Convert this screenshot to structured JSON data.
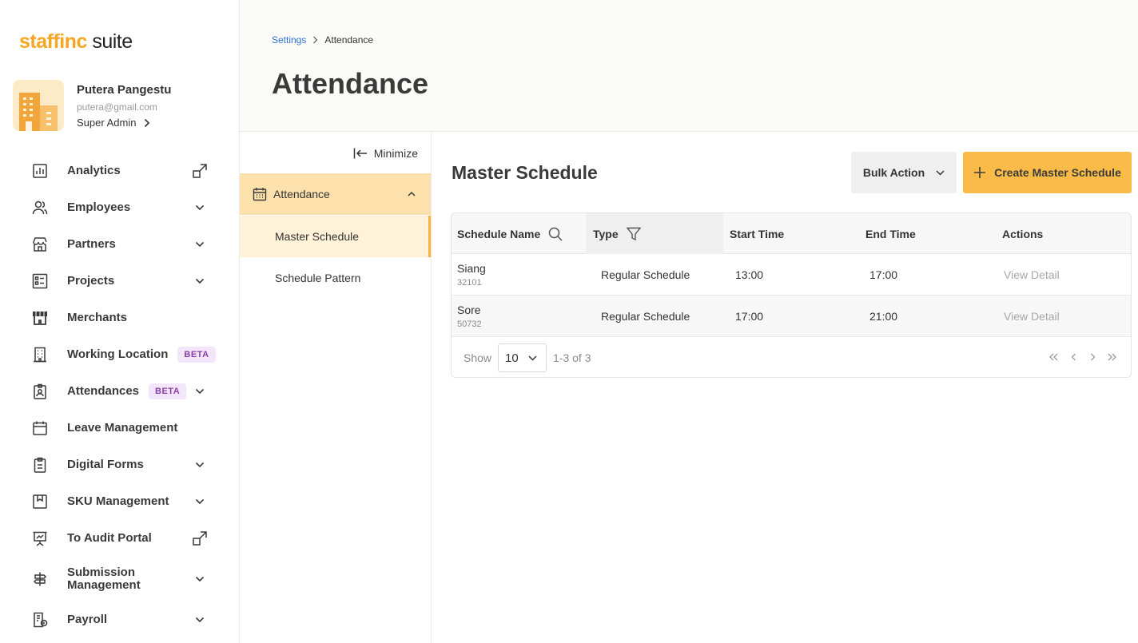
{
  "app": {
    "logo_brand": "staffinc",
    "logo_suffix": " suite",
    "accent_color": "#fbbb48"
  },
  "user": {
    "name": "Putera Pangestu",
    "email": "putera@gmail.com",
    "role": "Super Admin"
  },
  "sidebar": {
    "items": [
      {
        "label": "Analytics",
        "icon": "chart-icon",
        "right": "external-link"
      },
      {
        "label": "Employees",
        "icon": "users-icon",
        "right": "chevron-down"
      },
      {
        "label": "Partners",
        "icon": "store-icon",
        "right": "chevron-down"
      },
      {
        "label": "Projects",
        "icon": "list-icon",
        "right": "chevron-down"
      },
      {
        "label": "Merchants",
        "icon": "shop-icon",
        "right": ""
      },
      {
        "label": "Working Location",
        "icon": "building-icon",
        "badge": "BETA",
        "right": ""
      },
      {
        "label": "Attendances",
        "icon": "badge-icon",
        "badge": "BETA",
        "right": "chevron-down"
      },
      {
        "label": "Leave Management",
        "icon": "calendar-icon",
        "right": ""
      },
      {
        "label": "Digital Forms",
        "icon": "clipboard-icon",
        "right": "chevron-down"
      },
      {
        "label": "SKU Management",
        "icon": "bookmark-icon",
        "right": "chevron-down"
      },
      {
        "label": "To Audit Portal",
        "icon": "presentation-icon",
        "right": "external-link"
      },
      {
        "label": "Submission Management",
        "icon": "signpost-icon",
        "right": "chevron-down"
      },
      {
        "label": "Payroll",
        "icon": "payroll-icon",
        "right": "chevron-down"
      }
    ]
  },
  "header": {
    "breadcrumb_parent": "Settings",
    "breadcrumb_current": "Attendance",
    "title": "Attendance"
  },
  "subnav": {
    "minimize_label": "Minimize",
    "group_label": "Attendance",
    "items": [
      "Master Schedule",
      "Schedule Pattern"
    ]
  },
  "main": {
    "title": "Master Schedule",
    "bulk_action_label": "Bulk Action",
    "create_label": "Create Master Schedule",
    "table": {
      "columns": [
        "Schedule Name",
        "Type",
        "Start Time",
        "End Time",
        "Actions"
      ],
      "rows": [
        {
          "name": "Siang",
          "code": "32101",
          "type": "Regular Schedule",
          "start": "13:00",
          "end": "17:00",
          "action": "View Detail"
        },
        {
          "name": "Sore",
          "code": "50732",
          "type": "Regular Schedule",
          "start": "17:00",
          "end": "21:00",
          "action": "View Detail"
        }
      ]
    },
    "pagination": {
      "show_label": "Show",
      "page_size": "10",
      "range": "1-3 of 3"
    }
  }
}
